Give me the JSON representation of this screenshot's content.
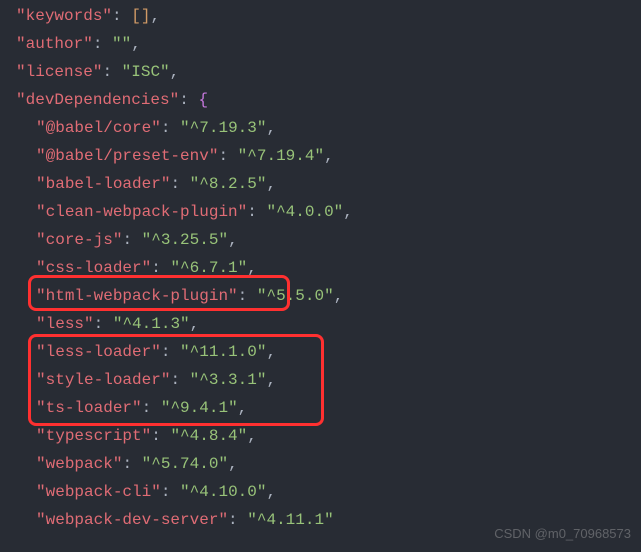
{
  "top_entries": [
    {
      "key": "keywords",
      "value": "[]",
      "is_array": true
    },
    {
      "key": "author",
      "value": "\"\""
    },
    {
      "key": "license",
      "value": "\"ISC\""
    }
  ],
  "devdeps_key": "devDependencies",
  "dev_dependencies": [
    {
      "name": "@babel/core",
      "version": "^7.19.3"
    },
    {
      "name": "@babel/preset-env",
      "version": "^7.19.4"
    },
    {
      "name": "babel-loader",
      "version": "^8.2.5"
    },
    {
      "name": "clean-webpack-plugin",
      "version": "^4.0.0"
    },
    {
      "name": "core-js",
      "version": "^3.25.5"
    },
    {
      "name": "css-loader",
      "version": "^6.7.1"
    },
    {
      "name": "html-webpack-plugin",
      "version": "^5.5.0"
    },
    {
      "name": "less",
      "version": "^4.1.3"
    },
    {
      "name": "less-loader",
      "version": "^11.1.0"
    },
    {
      "name": "style-loader",
      "version": "^3.3.1"
    },
    {
      "name": "ts-loader",
      "version": "^9.4.1"
    },
    {
      "name": "typescript",
      "version": "^4.8.4"
    },
    {
      "name": "webpack",
      "version": "^5.74.0"
    },
    {
      "name": "webpack-cli",
      "version": "^4.10.0"
    },
    {
      "name": "webpack-dev-server",
      "version": "^4.11.1"
    }
  ],
  "watermark": "CSDN @m0_70968573"
}
